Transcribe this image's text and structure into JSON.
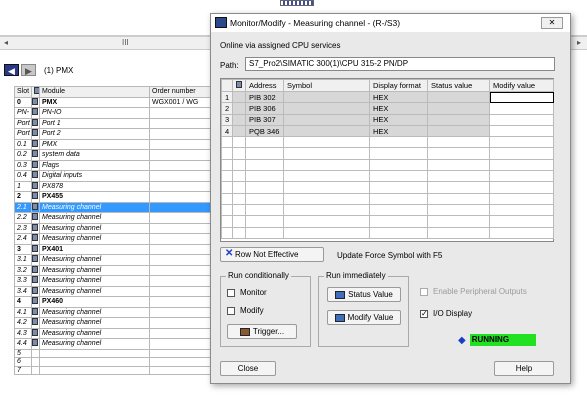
{
  "background": {
    "scroll_dots": "III",
    "rack_title": "(1)  PMX",
    "columns": {
      "slot": "Slot",
      "module": "Module",
      "order": "Order number"
    },
    "rows": [
      {
        "slot": "0",
        "module": "PMX",
        "order": "WGX001 / WG",
        "bold": true
      },
      {
        "slot": "PN-",
        "module": "PN-IO",
        "order": ""
      },
      {
        "slot": "Port",
        "module": "Port 1",
        "order": ""
      },
      {
        "slot": "Port",
        "module": "Port 2",
        "order": ""
      },
      {
        "slot": "0.1",
        "module": "PMX",
        "order": ""
      },
      {
        "slot": "0.2",
        "module": "system data",
        "order": ""
      },
      {
        "slot": "0.3",
        "module": "Flags",
        "order": ""
      },
      {
        "slot": "0.4",
        "module": "Digital inputs",
        "order": ""
      },
      {
        "slot": "1",
        "module": "PX878",
        "order": ""
      },
      {
        "slot": "2",
        "module": "PX455",
        "order": "",
        "bold": true
      },
      {
        "slot": "2.1",
        "module": "Measuring channel",
        "order": "",
        "selected": true
      },
      {
        "slot": "2.2",
        "module": "Measuring channel",
        "order": ""
      },
      {
        "slot": "2.3",
        "module": "Measuring channel",
        "order": ""
      },
      {
        "slot": "2.4",
        "module": "Measuring channel",
        "order": ""
      },
      {
        "slot": "3",
        "module": "PX401",
        "order": "",
        "bold": true
      },
      {
        "slot": "3.1",
        "module": "Measuring channel",
        "order": ""
      },
      {
        "slot": "3.2",
        "module": "Measuring channel",
        "order": ""
      },
      {
        "slot": "3.3",
        "module": "Measuring channel",
        "order": ""
      },
      {
        "slot": "3.4",
        "module": "Measuring channel",
        "order": ""
      },
      {
        "slot": "4",
        "module": "PX460",
        "order": "",
        "bold": true
      },
      {
        "slot": "4.1",
        "module": "Measuring channel",
        "order": ""
      },
      {
        "slot": "4.2",
        "module": "Measuring channel",
        "order": ""
      },
      {
        "slot": "4.3",
        "module": "Measuring channel",
        "order": ""
      },
      {
        "slot": "4.4",
        "module": "Measuring channel",
        "order": ""
      },
      {
        "slot": "5",
        "module": "",
        "order": ""
      },
      {
        "slot": "6",
        "module": "",
        "order": ""
      },
      {
        "slot": "7",
        "module": "",
        "order": ""
      }
    ]
  },
  "dialog": {
    "title": "Monitor/Modify - Measuring channel - (R-/S3)",
    "close_glyph": "✕",
    "online_text": "Online via assigned CPU services",
    "path_label": "Path:",
    "path_value": "S7_Pro2\\SIMATIC 300(1)\\CPU 315-2 PN/DP",
    "table": {
      "headers": [
        "",
        "",
        "Address",
        "Symbol",
        "Display format",
        "Status value",
        "Modify value"
      ],
      "rows": [
        {
          "n": "1",
          "address": "PIB  302",
          "symbol": "",
          "format": "HEX",
          "status": "",
          "modify": ""
        },
        {
          "n": "2",
          "address": "PIB  306",
          "symbol": "",
          "format": "HEX",
          "status": "",
          "modify": ""
        },
        {
          "n": "3",
          "address": "PIB  307",
          "symbol": "",
          "format": "HEX",
          "status": "",
          "modify": ""
        },
        {
          "n": "4",
          "address": "PQB  346",
          "symbol": "",
          "format": "HEX",
          "status": "",
          "modify": ""
        }
      ]
    },
    "force_button": "Row Not Effective",
    "force_desc": "Update Force Symbol with F5",
    "run_conditionally": {
      "title": "Run conditionally",
      "monitor": "Monitor",
      "modify": "Modify",
      "trigger": "Trigger..."
    },
    "run_immediately": {
      "title": "Run immediately",
      "status_value": "Status Value",
      "modify_value": "Modify Value"
    },
    "enable_peripheral": "Enable Peripheral Outputs",
    "io_display": "I/O Display",
    "io_display_checked": "✓",
    "status": "RUNNING",
    "close": "Close",
    "help": "Help"
  }
}
